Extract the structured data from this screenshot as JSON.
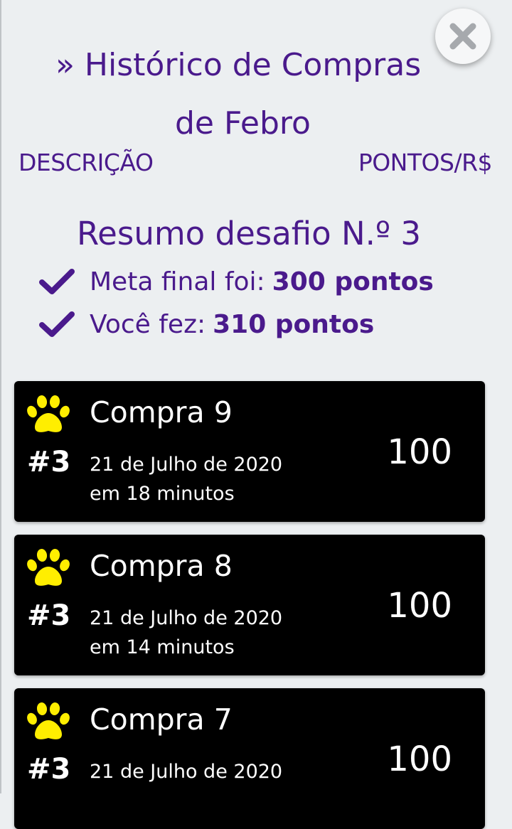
{
  "header": {
    "title_line1": "» Histórico de Compras",
    "title_line2": "de Febro",
    "col_description": "DESCRIÇÃO",
    "col_points": "PONTOS/R$"
  },
  "summary": {
    "title": "Resumo desafio N.º 3",
    "meta_label": "Meta final foi:",
    "meta_value": "300 pontos",
    "done_label": "Você fez:",
    "done_value": "310 pontos"
  },
  "purchases": [
    {
      "name": "Compra 9",
      "number": "#3",
      "date": "21 de Julho de 2020",
      "ago": "em 18 minutos",
      "value": "100"
    },
    {
      "name": "Compra 8",
      "number": "#3",
      "date": "21 de Julho de 2020",
      "ago": "em 14 minutos",
      "value": "100"
    },
    {
      "name": "Compra 7",
      "number": "#3",
      "date": "21 de Julho de 2020",
      "ago": "",
      "value": "100"
    }
  ],
  "icons": {
    "close": "close-icon",
    "check": "check-icon",
    "paw": "paw-icon"
  },
  "colors": {
    "accent": "#4a1a8c",
    "background": "#eceff1",
    "card": "#000000",
    "paw": "#ffee00"
  }
}
